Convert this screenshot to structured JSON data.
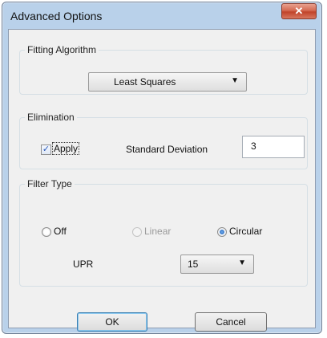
{
  "window": {
    "title": "Advanced Options",
    "close_glyph": "✕"
  },
  "fitting": {
    "legend": "Fitting Algorithm",
    "algorithm": "Least Squares",
    "arrow": "▼"
  },
  "elimination": {
    "legend": "Elimination",
    "apply_label": "Apply",
    "apply_checked": true,
    "check_glyph": "✓",
    "std_dev_label": "Standard Deviation",
    "std_dev_value": "3"
  },
  "filter": {
    "legend": "Filter Type",
    "options": [
      {
        "label": "Off"
      },
      {
        "label": "Linear",
        "disabled": true
      },
      {
        "label": "Circular",
        "selected": true
      }
    ],
    "upr_label": "UPR",
    "upr_value": "15",
    "arrow": "▼"
  },
  "buttons": {
    "ok": "OK",
    "cancel": "Cancel"
  },
  "colors": {
    "frame": "#b9d1ea",
    "client": "#f0f0f0",
    "close": "#c0432a",
    "radio_selected": "#1f5fb8"
  }
}
